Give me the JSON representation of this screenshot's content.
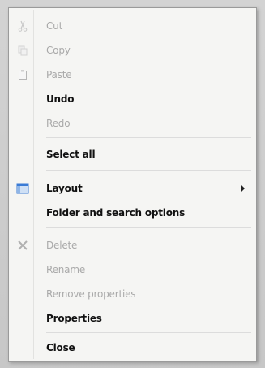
{
  "context_menu": {
    "items": [
      {
        "label": "Cut",
        "state": "disabled",
        "icon": "scissors-icon"
      },
      {
        "label": "Copy",
        "state": "disabled",
        "icon": "copy-icon"
      },
      {
        "label": "Paste",
        "state": "disabled",
        "icon": "paste-icon"
      },
      {
        "label": "Undo",
        "state": "enabled"
      },
      {
        "label": "Redo",
        "state": "disabled"
      },
      {
        "label": "Select all",
        "state": "enabled"
      },
      {
        "label": "Layout",
        "state": "enabled",
        "icon": "layout-icon",
        "has_submenu": true
      },
      {
        "label": "Folder and search options",
        "state": "enabled"
      },
      {
        "label": "Delete",
        "state": "disabled",
        "icon": "delete-icon"
      },
      {
        "label": "Rename",
        "state": "disabled"
      },
      {
        "label": "Remove properties",
        "state": "disabled"
      },
      {
        "label": "Properties",
        "state": "enabled"
      },
      {
        "label": "Close",
        "state": "enabled"
      }
    ]
  },
  "colors": {
    "menu_background": "#f5f5f3",
    "enabled_text": "#1b1b1b",
    "disabled_text": "#a9a9a9",
    "layout_icon_blue": "#3a7bd5"
  }
}
